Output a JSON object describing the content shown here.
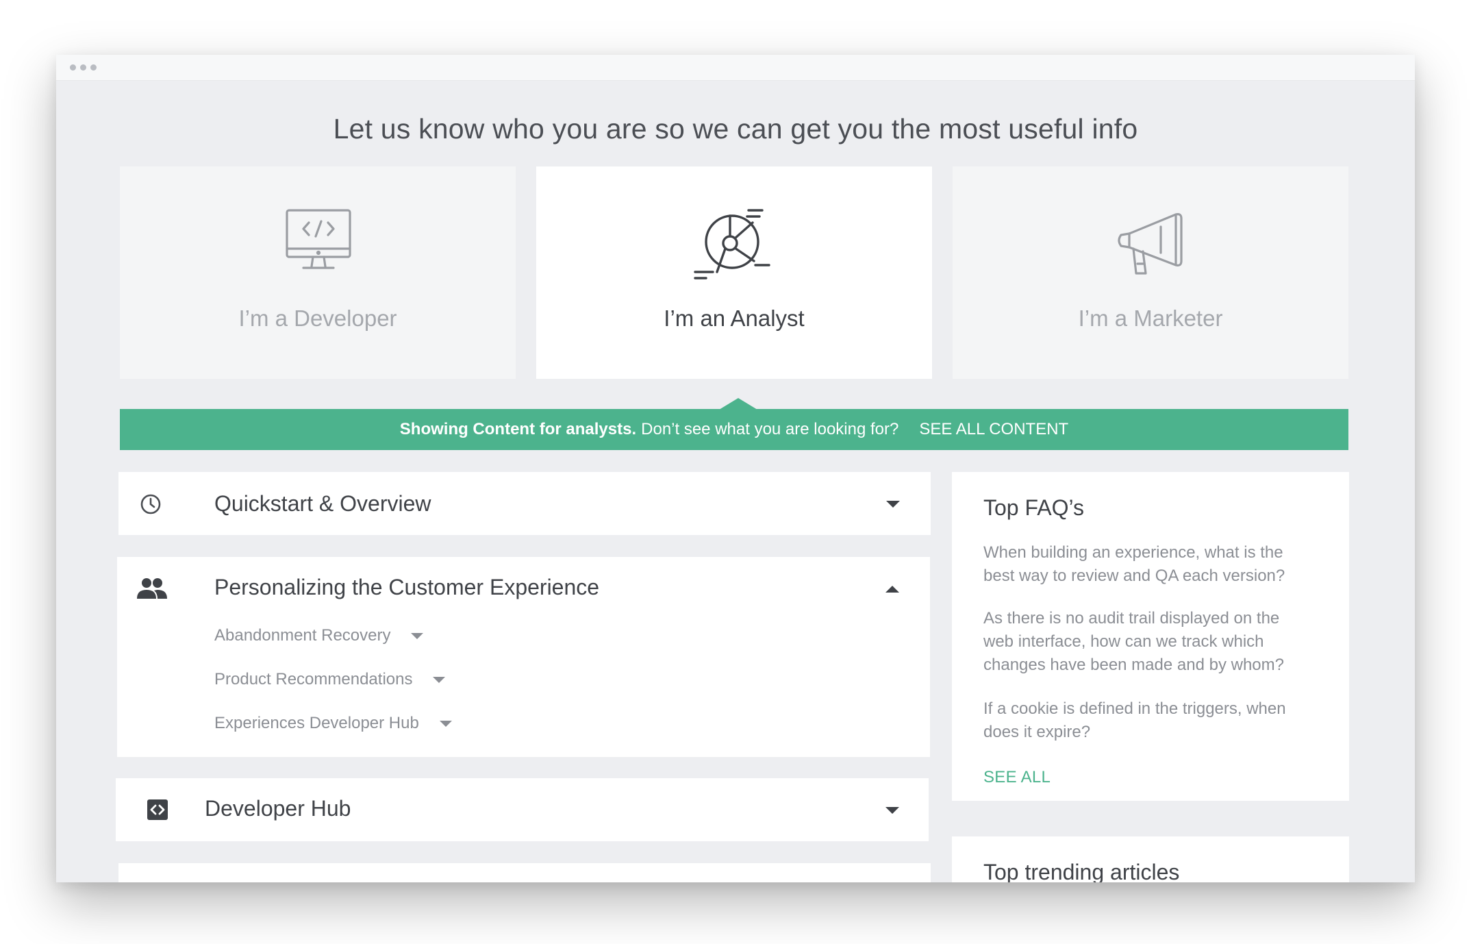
{
  "window": {
    "dots": [
      "dot",
      "dot",
      "dot"
    ]
  },
  "headline": "Let us know who you are so we can get you the most useful info",
  "personas": [
    {
      "label": "I’m a Developer",
      "icon": "monitor-code-icon",
      "active": false
    },
    {
      "label": "I’m an Analyst",
      "icon": "analytics-chart-icon",
      "active": true
    },
    {
      "label": "I’m a Marketer",
      "icon": "megaphone-icon",
      "active": false
    }
  ],
  "banner": {
    "strong": "Showing Content for analysts.",
    "text": "Don’t see what you are looking for?",
    "link": "SEE ALL CONTENT",
    "color": "#4cb38d"
  },
  "sections": [
    {
      "title": "Quickstart & Overview",
      "icon": "clock-icon",
      "expanded": false
    },
    {
      "title": "Personalizing the Customer Experience",
      "icon": "users-icon",
      "expanded": true,
      "items": [
        "Abandonment Recovery",
        "Product Recommendations",
        "Experiences Developer Hub"
      ]
    },
    {
      "title": "Developer Hub",
      "icon": "code-brackets-icon",
      "expanded": false
    }
  ],
  "faq": {
    "title": "Top FAQ’s",
    "items": [
      "When building an experience, what is the best way to review and QA each version?",
      "As there is no audit trail displayed on the web interface, how can we track which changes have been made and by whom?",
      "If a cookie is defined in the triggers, when does it expire?"
    ],
    "see_all": "SEE ALL"
  },
  "trending": {
    "title": "Top trending articles"
  }
}
